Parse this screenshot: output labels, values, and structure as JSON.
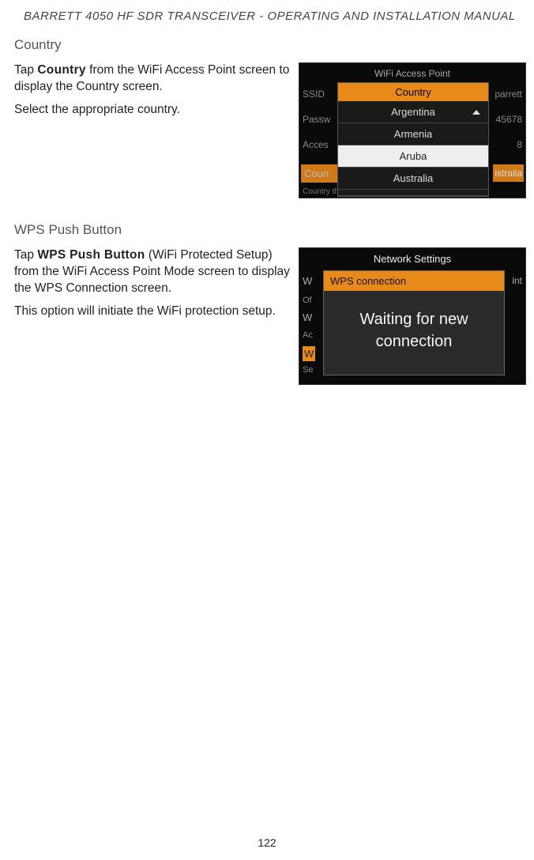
{
  "header": "BARRETT 4050 HF SDR TRANSCEIVER - OPERATING AND INSTALLATION MANUAL",
  "country": {
    "title": "Country",
    "para1_pre": "Tap ",
    "para1_kw": "Country",
    "para1_post": " from the WiFi Access Point screen to display the Country screen.",
    "para2": "Select the appropriate country.",
    "shot": {
      "bg_title": "WiFi Access Point",
      "bg_rows": [
        "SSID",
        "Passw",
        "Acces"
      ],
      "bg_right": [
        "parrett",
        "45678",
        "8"
      ],
      "coun": "Coun",
      "istralia": "istralia",
      "helptext": "Country that the access point is operating in",
      "popup_header": "Country",
      "items": [
        "Argentina",
        "Armenia",
        "Aruba",
        "Australia"
      ]
    }
  },
  "wps": {
    "title": "WPS Push Button",
    "para1_pre": "Tap ",
    "para1_kw": "WPS Push Button",
    "para1_post": " (WiFi Protected Setup) from the WiFi Access Point Mode screen to display the WPS Connection screen.",
    "para2": "This option will initiate the WiFi protection setup.",
    "shot": {
      "title": "Network Settings",
      "left": [
        "W",
        "Of",
        "W",
        "Ac",
        "W",
        "Se"
      ],
      "right": "int",
      "popup_header": "WPS connection",
      "popup_body": "Waiting for new connection"
    }
  },
  "page": "122"
}
